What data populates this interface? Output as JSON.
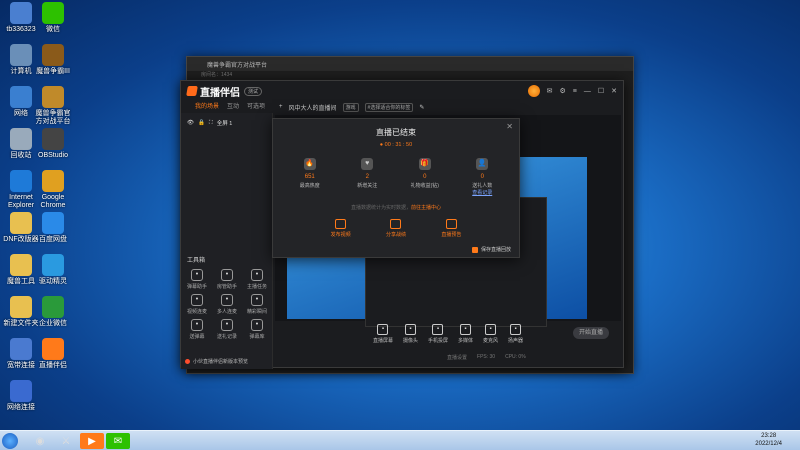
{
  "desktop": {
    "icons": [
      {
        "label": "tb336323",
        "icon": "user-icon",
        "color": "#4a7fd0"
      },
      {
        "label": "微信",
        "icon": "wechat-icon",
        "color": "#2dc100"
      },
      {
        "label": "计算机",
        "icon": "computer-icon",
        "color": "#6a8fb8"
      },
      {
        "label": "魔兽争霸III",
        "icon": "warcraft-icon",
        "color": "#8a5a1a"
      },
      {
        "label": "网络",
        "icon": "network-icon",
        "color": "#3a7fd0"
      },
      {
        "label": "魔兽争霸官方对战平台",
        "icon": "game-platform-icon",
        "color": "#c08a2a"
      },
      {
        "label": "回收站",
        "icon": "recycle-bin-icon",
        "color": "#9ab"
      },
      {
        "label": "OBStudio",
        "icon": "obs-icon",
        "color": "#444"
      },
      {
        "label": "Internet Explorer",
        "icon": "ie-icon",
        "color": "#1e7ad8"
      },
      {
        "label": "Google Chrome",
        "icon": "chrome-icon",
        "color": "#e0a020"
      },
      {
        "label": "DNF改版器",
        "icon": "folder-icon",
        "color": "#e8c050"
      },
      {
        "label": "百度网盘",
        "icon": "baidu-disk-icon",
        "color": "#2a8ae8"
      },
      {
        "label": "魔兽工具",
        "icon": "folder-icon",
        "color": "#e8c050"
      },
      {
        "label": "驱动精灵",
        "icon": "driver-icon",
        "color": "#2a9ae0"
      },
      {
        "label": "新建文件夹",
        "icon": "folder-icon",
        "color": "#e8c050"
      },
      {
        "label": "企业微信",
        "icon": "wecom-icon",
        "color": "#2a9a3a"
      },
      {
        "label": "宽带连接",
        "icon": "broadband-icon",
        "color": "#4a7ad0"
      },
      {
        "label": "直播伴侣",
        "icon": "live-companion-icon",
        "color": "#ff7a1a"
      },
      {
        "label": "网络连接",
        "icon": "network-connect-icon",
        "color": "#3a6ad0"
      }
    ]
  },
  "taskbar": {
    "time": "23:28",
    "date": "2022/12/4"
  },
  "back_window": {
    "title": "魔兽争霸官方对战平台",
    "sub": "房间名：1434"
  },
  "app": {
    "logo": "直播伴侣",
    "beta": "测试",
    "tabs": [
      "我的场景",
      "互动",
      "可选项"
    ],
    "scene": "全屏 1",
    "stream_title": "风中大人的直播间",
    "category_chip": "游戏",
    "tag_chip": "#选择适合你的标签",
    "tools_title": "工具箱",
    "tools": [
      {
        "label": "弹幕助手",
        "icon": "danmaku-icon"
      },
      {
        "label": "房管助手",
        "icon": "admin-icon"
      },
      {
        "label": "主播任务",
        "icon": "task-icon"
      },
      {
        "label": "视频连麦",
        "icon": "video-link-icon"
      },
      {
        "label": "多人连麦",
        "icon": "multi-link-icon"
      },
      {
        "label": "精彩瞬间",
        "icon": "highlight-icon"
      },
      {
        "label": "送弹幕",
        "icon": "send-danmaku-icon"
      },
      {
        "label": "送礼记录",
        "icon": "gift-record-icon"
      },
      {
        "label": "弹幕库",
        "icon": "danmaku-lib-icon"
      }
    ],
    "promo": "小伙直播伴侣新版本预览",
    "controls": [
      {
        "label": "直播屏幕",
        "icon": "screen-icon"
      },
      {
        "label": "摄像头",
        "icon": "camera-icon"
      },
      {
        "label": "手机投屏",
        "icon": "phone-cast-icon"
      },
      {
        "label": "多媒体",
        "icon": "media-icon"
      },
      {
        "label": "麦克风",
        "icon": "mic-icon"
      },
      {
        "label": "扬声器",
        "icon": "speaker-icon"
      }
    ],
    "start_label": "开始直播",
    "status": [
      "直播设置",
      "FPS: 30",
      "CPU: 0%"
    ]
  },
  "modal": {
    "title": "直播已结束",
    "time": "00 : 31 : 50",
    "stats": [
      {
        "value": "651",
        "label": "最高热度",
        "icon": "flame-icon"
      },
      {
        "value": "2",
        "label": "新增关注",
        "icon": "heart-icon"
      },
      {
        "value": "0",
        "label": "礼物收益(钻)",
        "icon": "gift-icon"
      },
      {
        "value": "0",
        "label": "送礼人数",
        "link": "查看记录",
        "icon": "people-icon"
      }
    ],
    "note_prefix": "直播数据统计为实时数据，",
    "note_link": "前往主播中心",
    "actions": [
      {
        "label": "发布视频",
        "icon": "video-icon"
      },
      {
        "label": "分享战绩",
        "icon": "share-icon"
      },
      {
        "label": "直播预告",
        "icon": "announce-icon"
      }
    ],
    "footer": "保存直播回放"
  }
}
